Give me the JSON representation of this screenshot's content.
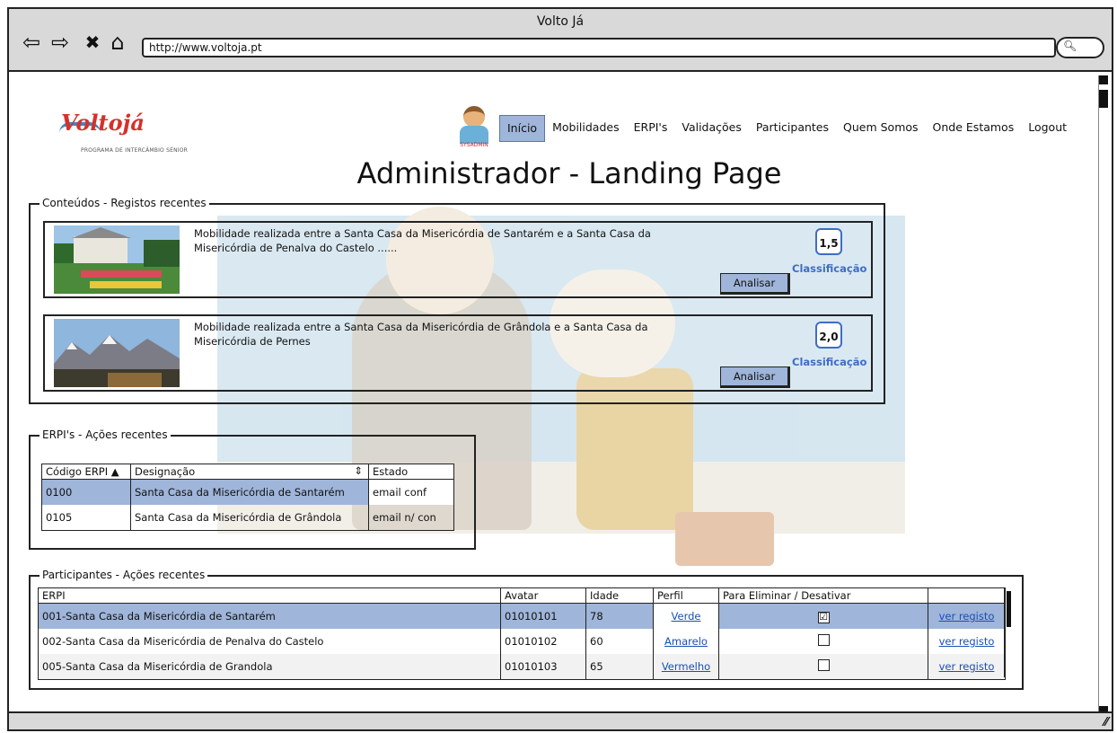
{
  "window": {
    "title": "Volto Já",
    "url": "http://www.voltoja.pt"
  },
  "logo": {
    "mark": "Voltojá",
    "subtitle": "PROGRAMA DE INTERCÂMBIO SÉNIOR"
  },
  "avatar": {
    "caption": "SYSADMIN"
  },
  "nav": {
    "items": [
      "Início",
      "Mobilidades",
      "ERPI's",
      "Validações",
      "Participantes",
      "Quem Somos",
      "Onde Estamos",
      "Logout"
    ],
    "active": "Início"
  },
  "page_title": "Administrador - Landing Page",
  "conteudos": {
    "legend": "Conteúdos - Registos recentes",
    "cards": [
      {
        "text": "Mobilidade realizada entre a Santa Casa da Misericórdia de Santarém e a Santa Casa da Misericórdia de Penalva do Castelo ......",
        "score": "1,5",
        "score_label": "Classificação",
        "button": "Analisar"
      },
      {
        "text": "Mobilidade realizada entre a Santa Casa da Misericórdia de Grândola e a Santa Casa da Misericórdia de Pernes",
        "score": "2,0",
        "score_label": "Classificação",
        "button": "Analisar"
      }
    ]
  },
  "erpis": {
    "legend": "ERPI's - Ações recentes",
    "columns": [
      "Código ERPI ▲",
      "Designação",
      "Estado"
    ],
    "rows": [
      {
        "codigo": "0100",
        "designacao": "Santa Casa da Misericórdia de Santarém",
        "estado": "email conf"
      },
      {
        "codigo": "0105",
        "designacao": "Santa Casa da Misericórdia de Grândola",
        "estado": "email n/ con"
      }
    ]
  },
  "participantes": {
    "legend": "Participantes - Ações recentes",
    "columns": [
      "ERPI",
      "Avatar",
      "Idade",
      "Perfil",
      "Para Eliminar / Desativar",
      ""
    ],
    "rows": [
      {
        "erpi": "001-Santa Casa da Misericórdia de Santarém",
        "avatar": "01010101",
        "idade": "78",
        "perfil": "Verde",
        "eliminar": "☑",
        "link": "ver registo"
      },
      {
        "erpi": "002-Santa Casa da Misericórdia de Penalva do Castelo",
        "avatar": "01010102",
        "idade": "60",
        "perfil": "Amarelo",
        "eliminar": "",
        "link": "ver registo"
      },
      {
        "erpi": "005-Santa Casa da Misericórdia de Grandola",
        "avatar": "01010103",
        "idade": "65",
        "perfil": "Vermelho",
        "eliminar": "",
        "link": "ver registo"
      }
    ]
  },
  "icons": {
    "back": "arrow-left-icon",
    "forward": "arrow-right-icon",
    "stop": "close-icon",
    "home": "home-icon",
    "search": "search-icon"
  },
  "colors": {
    "accent": "#9fb5d9",
    "link": "#1a4fb5",
    "score_border": "#3f6dc5"
  }
}
